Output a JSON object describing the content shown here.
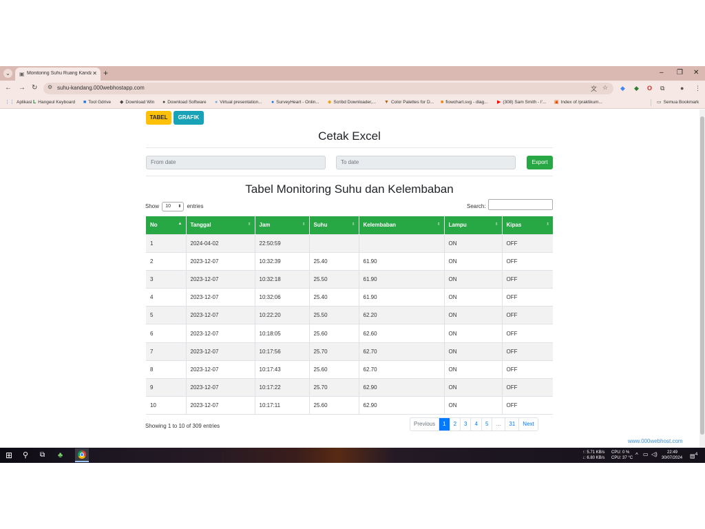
{
  "browser": {
    "tab_title": "Monitoring Suhu Ruang Kanda...",
    "url": "suhu-kandang.000webhostapp.com",
    "bookmarks": [
      "Aplikasi",
      "Hangeul Keyboard",
      "Tool Gdrive",
      "Download Win",
      "Download Software",
      "Virtual presentation...",
      "SurveyHeart - Onlin...",
      "Scribd Downloader,...",
      "Color Palettes for D...",
      "flowchart.svg - diag...",
      "(308) Sam Smith - I'...",
      "Index of /praktikum..."
    ],
    "all_bookmarks": "Semua Bookmark"
  },
  "page": {
    "btn_tabel": "TABEL",
    "btn_grafik": "GRAFIK",
    "cetak_title": "Cetak Excel",
    "from_placeholder": "From date",
    "to_placeholder": "To date",
    "export_label": "Export",
    "table_title": "Tabel Monitoring Suhu dan Kelembaban",
    "show_label": "Show",
    "entries_value": "10",
    "entries_label": "entries",
    "search_label": "Search:",
    "columns": [
      "No",
      "Tanggal",
      "Jam",
      "Suhu",
      "Kelembaban",
      "Lampu",
      "Kipas"
    ],
    "rows": [
      [
        "1",
        "2024-04-02",
        "22:50:59",
        "",
        "",
        "ON",
        "OFF"
      ],
      [
        "2",
        "2023-12-07",
        "10:32:39",
        "25.40",
        "61.90",
        "ON",
        "OFF"
      ],
      [
        "3",
        "2023-12-07",
        "10:32:18",
        "25.50",
        "61.90",
        "ON",
        "OFF"
      ],
      [
        "4",
        "2023-12-07",
        "10:32:06",
        "25.40",
        "61.90",
        "ON",
        "OFF"
      ],
      [
        "5",
        "2023-12-07",
        "10:22:20",
        "25.50",
        "62.20",
        "ON",
        "OFF"
      ],
      [
        "6",
        "2023-12-07",
        "10:18:05",
        "25.60",
        "62.60",
        "ON",
        "OFF"
      ],
      [
        "7",
        "2023-12-07",
        "10:17:56",
        "25.70",
        "62.70",
        "ON",
        "OFF"
      ],
      [
        "8",
        "2023-12-07",
        "10:17:43",
        "25.60",
        "62.70",
        "ON",
        "OFF"
      ],
      [
        "9",
        "2023-12-07",
        "10:17:22",
        "25.70",
        "62.90",
        "ON",
        "OFF"
      ],
      [
        "10",
        "2023-12-07",
        "10:17:11",
        "25.60",
        "62.90",
        "ON",
        "OFF"
      ]
    ],
    "info": "Showing 1 to 10 of 309 entries",
    "pagination": [
      "Previous",
      "1",
      "2",
      "3",
      "4",
      "5",
      "…",
      "31",
      "Next"
    ],
    "watermark": "www.000webhost.com"
  },
  "taskbar": {
    "net_up": "↑: 5.71 KB/s",
    "net_down": "↓: 6.80 KB/s",
    "cpu": "CPU: 0 %",
    "cpu_temp": "CPU: 37 °C",
    "time": "22:49",
    "date": "30/07/2024",
    "notif_count": "4"
  },
  "colors": {
    "accent_green": "#28a745",
    "tabel_yellow": "#ffc107",
    "grafik_teal": "#17a2b8",
    "link_blue": "#007bff"
  }
}
